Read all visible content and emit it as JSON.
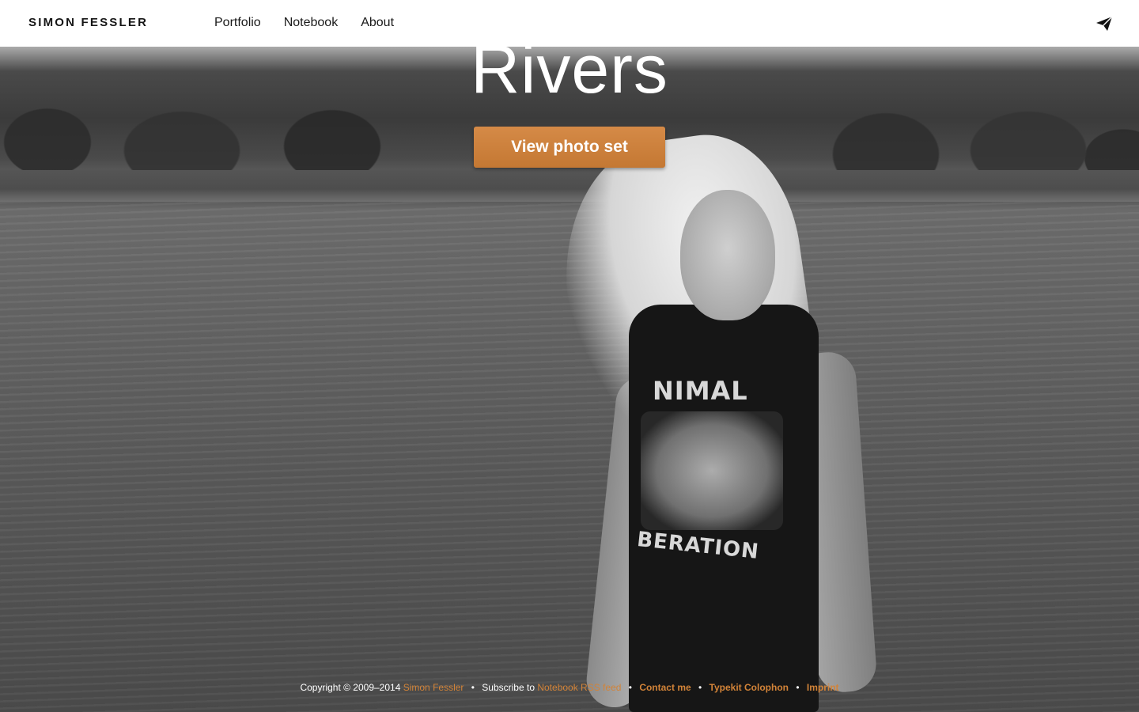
{
  "header": {
    "brand": "SIMON FESSLER",
    "nav": [
      {
        "label": "Portfolio"
      },
      {
        "label": "Notebook"
      },
      {
        "label": "About"
      }
    ],
    "contact_icon": "paper-plane-icon"
  },
  "hero": {
    "title": "Rivers",
    "cta_label": "View photo set",
    "image": "black-and-white photo of a blonde woman in a black sleeveless shirt standing in a river with trees behind",
    "shirt_text_top": "NIMAL",
    "shirt_text_bottom": "BERATION"
  },
  "footer": {
    "copyright": "Copyright © 2009–2014",
    "author_link": "Simon Fessler",
    "subscribe_text": "Subscribe to",
    "rss_link": "Notebook RSS feed",
    "contact_link": "Contact me",
    "colophon_link": "Typekit Colophon",
    "imprint_link": "Imprint",
    "separator": "•"
  },
  "colors": {
    "accent": "#d28338",
    "button": "#c9803c",
    "header_bg": "#ffffff",
    "text_dark": "#151515"
  }
}
